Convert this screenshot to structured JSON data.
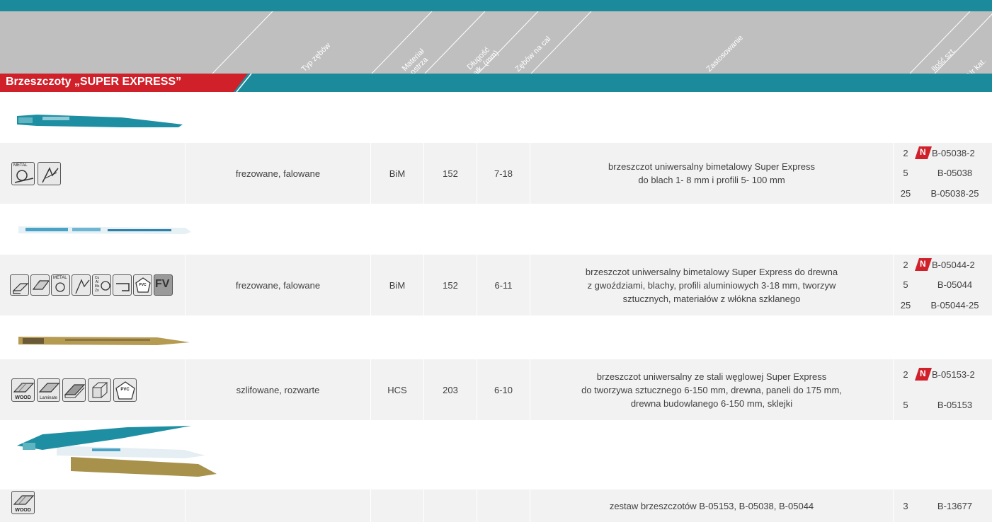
{
  "header": {
    "columns": [
      "Typ zębów",
      "Materiał ostrza",
      "Długość całk. (mm)",
      "Zębów na cal",
      "Zastosowanie",
      "Ilość szt.",
      "Nr kat."
    ]
  },
  "section": {
    "title": "Brzeszczoty „SUPER EXPRESS”"
  },
  "new_badge": "N",
  "rows": [
    {
      "icons": [
        "metal-icon",
        "profile-icon"
      ],
      "teeth": "frezowane, falowane",
      "material": "BiM",
      "length": "152",
      "tpi": "7-18",
      "desc": [
        "brzeszczot uniwersalny bimetalowy Super Express",
        "do blach 1- 8 mm i profili 5- 100 mm"
      ],
      "items": [
        {
          "qty": "2",
          "cat": "B-05038-2",
          "new": true
        },
        {
          "qty": "5",
          "cat": "B-05038",
          "new": false
        },
        {
          "qty": "25",
          "cat": "B-05038-25",
          "new": false
        }
      ]
    },
    {
      "icons": [
        "wood-nails-icon",
        "wood-icon",
        "metal-icon",
        "profile-icon",
        "non-ferrous-icon",
        "pipe-icon",
        "pvc-icon",
        "fiberglass-icon"
      ],
      "teeth": "frezowane, falowane",
      "material": "BiM",
      "length": "152",
      "tpi": "6-11",
      "desc": [
        "brzeszczot uniwersalny bimetalowy Super Express do drewna",
        "z gwoździami, blachy, profili aluminiowych 3-18 mm, tworzyw",
        "sztucznych, materiałów z włókna szklanego"
      ],
      "items": [
        {
          "qty": "2",
          "cat": "B-05044-2",
          "new": true
        },
        {
          "qty": "5",
          "cat": "B-05044",
          "new": false
        },
        {
          "qty": "25",
          "cat": "B-05044-25",
          "new": false
        }
      ]
    },
    {
      "icons": [
        "wood-icon",
        "laminate-icon",
        "panel-icon",
        "timber-icon",
        "pvc-icon"
      ],
      "teeth": "szlifowane, rozwarte",
      "material": "HCS",
      "length": "203",
      "tpi": "6-10",
      "desc": [
        "brzeszczot uniwersalny ze stali węglowej Super Express",
        "do tworzywa sztucznego 6-150 mm, drewna, paneli do 175 mm,",
        "drewna budowlanego 6-150 mm, sklejki"
      ],
      "items": [
        {
          "qty": "2",
          "cat": "B-05153-2",
          "new": true
        },
        {
          "qty": "5",
          "cat": "B-05153",
          "new": false
        }
      ]
    },
    {
      "icons": [
        "wood-icon"
      ],
      "teeth": "",
      "material": "",
      "length": "",
      "tpi": "",
      "desc": [
        "zestaw brzeszczotów B-05153, B-05038, B-05044"
      ],
      "items": [
        {
          "qty": "3",
          "cat": "B-13677",
          "new": false
        }
      ]
    }
  ],
  "icon_texts": {
    "metal": "METAL",
    "wood": "WOOD",
    "laminate": "Laminate",
    "pvc": "PVC",
    "fv": "FV",
    "nonferrous": "Cu Al Ms Zn"
  },
  "colors": {
    "teal": "#1b8a9a",
    "header_gray": "#bfbfbf",
    "row_gray": "#f2f2f2",
    "badge_red": "#d0202a"
  }
}
